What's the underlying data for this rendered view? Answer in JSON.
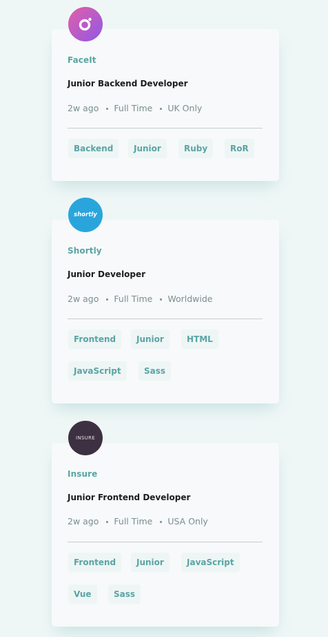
{
  "jobs": [
    {
      "company": "FaceIt",
      "position": "Junior Backend Developer",
      "posted": "2w ago",
      "contract": "Full Time",
      "location": "UK Only",
      "logo": {
        "icon": "faceit-logo",
        "colors": [
          "#e45ea8",
          "#8e59e6"
        ]
      },
      "tags": [
        "Backend",
        "Junior",
        "Ruby",
        "RoR"
      ]
    },
    {
      "company": "Shortly",
      "position": "Junior Developer",
      "posted": "2w ago",
      "contract": "Full Time",
      "location": "Worldwide",
      "logo": {
        "icon": "shortly-logo",
        "text": "shortly",
        "color": "#2aa5dc"
      },
      "tags": [
        "Frontend",
        "Junior",
        "HTML",
        "JavaScript",
        "Sass"
      ]
    },
    {
      "company": "Insure",
      "position": "Junior Frontend Developer",
      "posted": "2w ago",
      "contract": "Full Time",
      "location": "USA Only",
      "logo": {
        "icon": "insure-logo",
        "text": "INSURE",
        "color": "#3d3042"
      },
      "tags": [
        "Frontend",
        "Junior",
        "JavaScript",
        "Vue",
        "Sass"
      ]
    }
  ],
  "colors": {
    "accent": "#5ba4a4",
    "background": "#eff7f6",
    "card": "#f7f9fa",
    "tag_background": "#eef5f5"
  }
}
